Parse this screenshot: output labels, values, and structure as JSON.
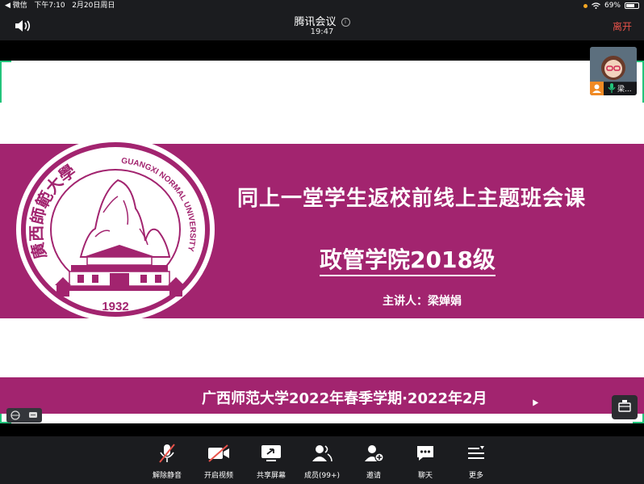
{
  "status_bar": {
    "back_app": "◀ 微信",
    "time": "下午7:10",
    "date": "2月20日周日",
    "battery_percent": "69%",
    "battery_level": 0.69
  },
  "meeting": {
    "title": "腾讯会议",
    "elapsed": "19:47",
    "leave_label": "离开"
  },
  "slide": {
    "title": "同上一堂学生返校前线上主题班会课",
    "subtitle": "政管学院2018级",
    "host": "主讲人：梁婵娟",
    "footer": "广西师范大学2022年春季学期·2022年2月",
    "seal_text_cn": "廣西師範大學",
    "seal_text_en": "GUANGXI NORMAL UNIVERSITY",
    "seal_year": "1932",
    "brand_color": "#a2246f"
  },
  "participant_tile": {
    "name": "梁..."
  },
  "toolbar": {
    "items": [
      {
        "label": "解除静音",
        "icon": "mic-muted-icon"
      },
      {
        "label": "开启视频",
        "icon": "camera-off-icon"
      },
      {
        "label": "共享屏幕",
        "icon": "share-screen-icon"
      },
      {
        "label": "成员(99+)",
        "icon": "members-icon"
      },
      {
        "label": "邀请",
        "icon": "invite-icon"
      },
      {
        "label": "聊天",
        "icon": "chat-icon"
      },
      {
        "label": "更多",
        "icon": "more-icon"
      }
    ]
  }
}
